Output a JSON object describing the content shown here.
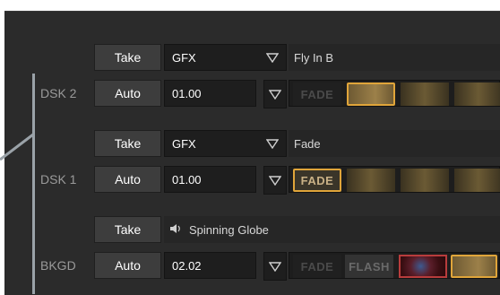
{
  "rows": {
    "dsk2": {
      "label": "DSK 2",
      "take_label": "Take",
      "auto_label": "Auto",
      "source": "GFX",
      "duration": "01.00",
      "item_name": "Fly In B",
      "transitions": [
        "FADE",
        "",
        "",
        ""
      ]
    },
    "dsk1": {
      "label": "DSK 1",
      "take_label": "Take",
      "auto_label": "Auto",
      "source": "GFX",
      "duration": "01.00",
      "item_name": "Fade",
      "transitions": [
        "FADE",
        "",
        "",
        ""
      ]
    },
    "bkgd": {
      "label": "BKGD",
      "take_label": "Take",
      "auto_label": "Auto",
      "duration": "02.02",
      "item_name": "Spinning Globe",
      "transitions": [
        "FADE",
        "FLASH",
        "",
        ""
      ]
    }
  },
  "icons": {
    "dropdown": "triangle-down-icon",
    "speaker": "speaker-icon"
  },
  "colors": {
    "panel_bg": "#2b2b2b",
    "button_bg": "#3d3d3d",
    "selected_border": "#e0a53a",
    "label_gray": "#9a9a9a"
  }
}
